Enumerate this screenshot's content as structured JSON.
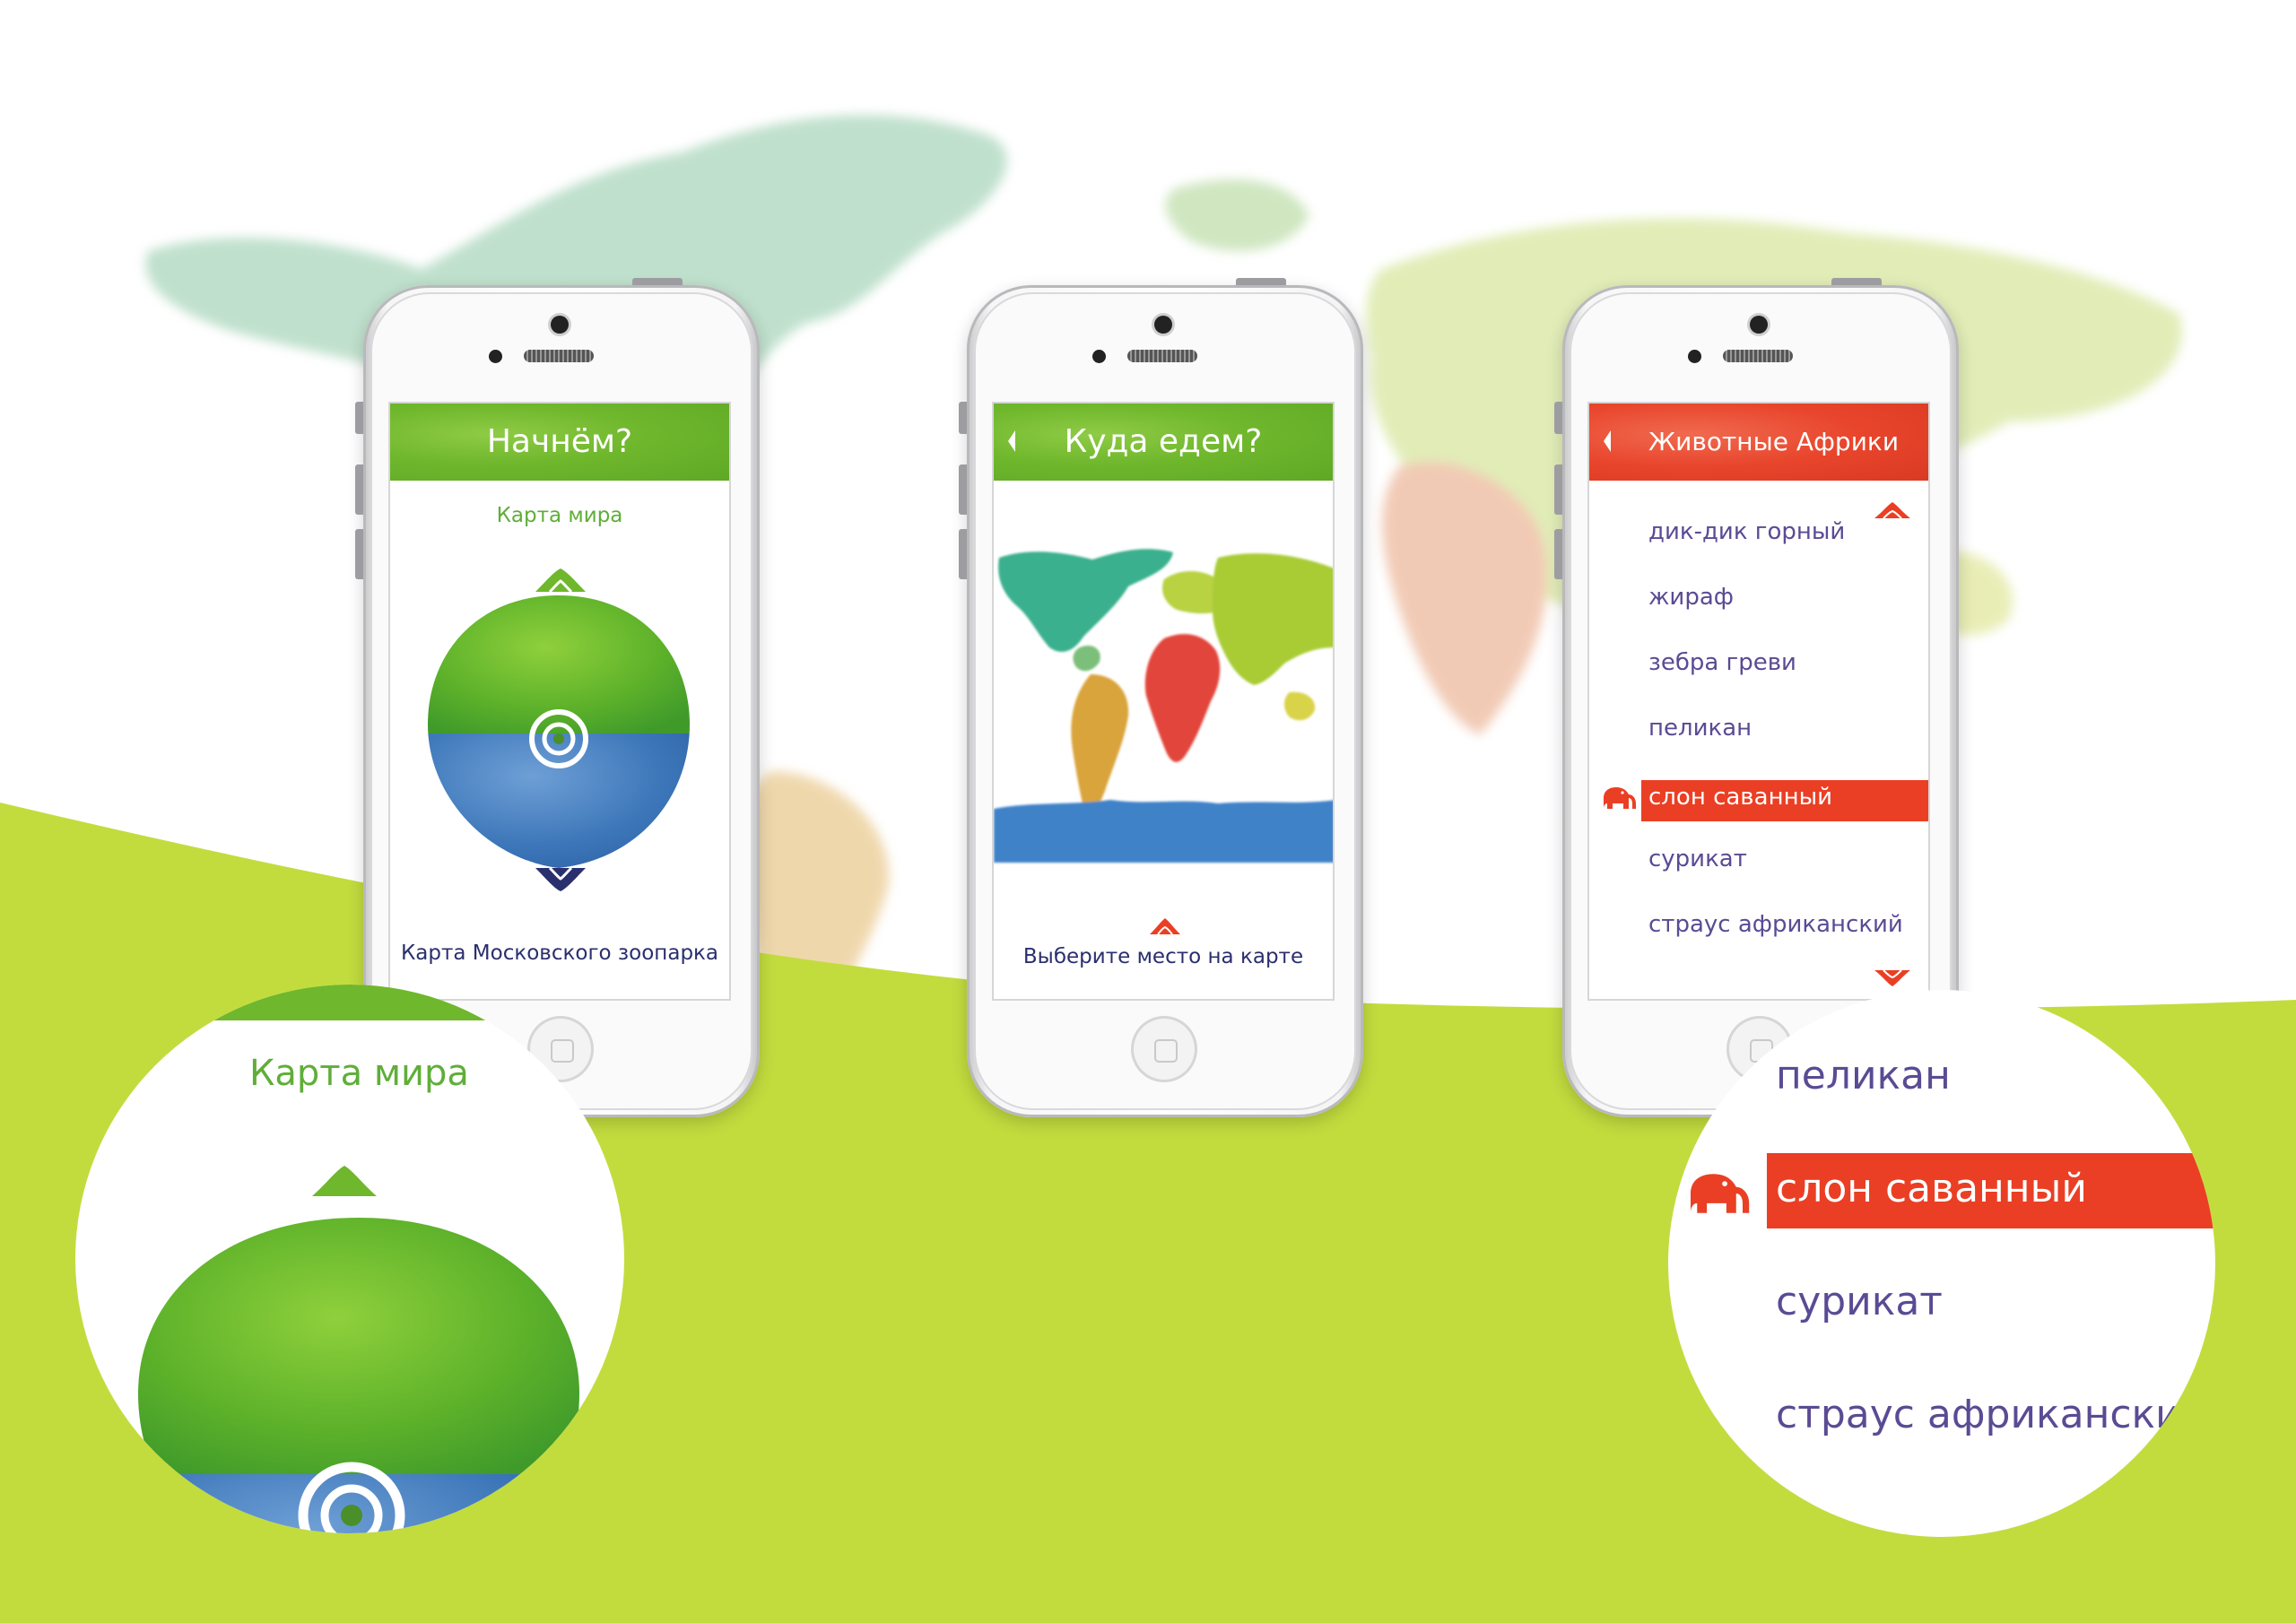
{
  "colors": {
    "lime_background": "#c2dc3e",
    "accent_green": "#6fb72c",
    "accent_red": "#ea3f24",
    "text_purple": "#5a4b94",
    "text_navy": "#2a2f6e"
  },
  "phone1": {
    "header_title": "Начнём?",
    "subtitle": "Карта мира",
    "bottom_label": "Карта Московского зоопарка",
    "icons": [
      "chevron-up-icon",
      "target-icon",
      "chevron-down-icon"
    ]
  },
  "phone2": {
    "header_title": "Куда едем?",
    "hint": "Выберите место на карте",
    "icons": [
      "back-icon",
      "world-map-image",
      "marker-icon"
    ]
  },
  "phone3": {
    "header_title": "Животные Африки",
    "items": [
      {
        "label": "дик-дик горный",
        "selected": false
      },
      {
        "label": "жираф",
        "selected": false
      },
      {
        "label": "зебра греви",
        "selected": false
      },
      {
        "label": "пеликан",
        "selected": false
      },
      {
        "label": "слон саванный",
        "selected": true
      },
      {
        "label": "сурикат",
        "selected": false
      },
      {
        "label": "страус африканский",
        "selected": false
      }
    ],
    "icons": [
      "back-icon",
      "scroll-up-icon",
      "elephant-icon",
      "scroll-down-icon"
    ]
  },
  "zoom_left": {
    "subtitle": "Карта мира"
  },
  "zoom_right": {
    "items": [
      {
        "label": "пеликан"
      },
      {
        "label": "слон саванный",
        "selected": true
      },
      {
        "label": "сурикат"
      },
      {
        "label": "страус африканский"
      }
    ]
  }
}
